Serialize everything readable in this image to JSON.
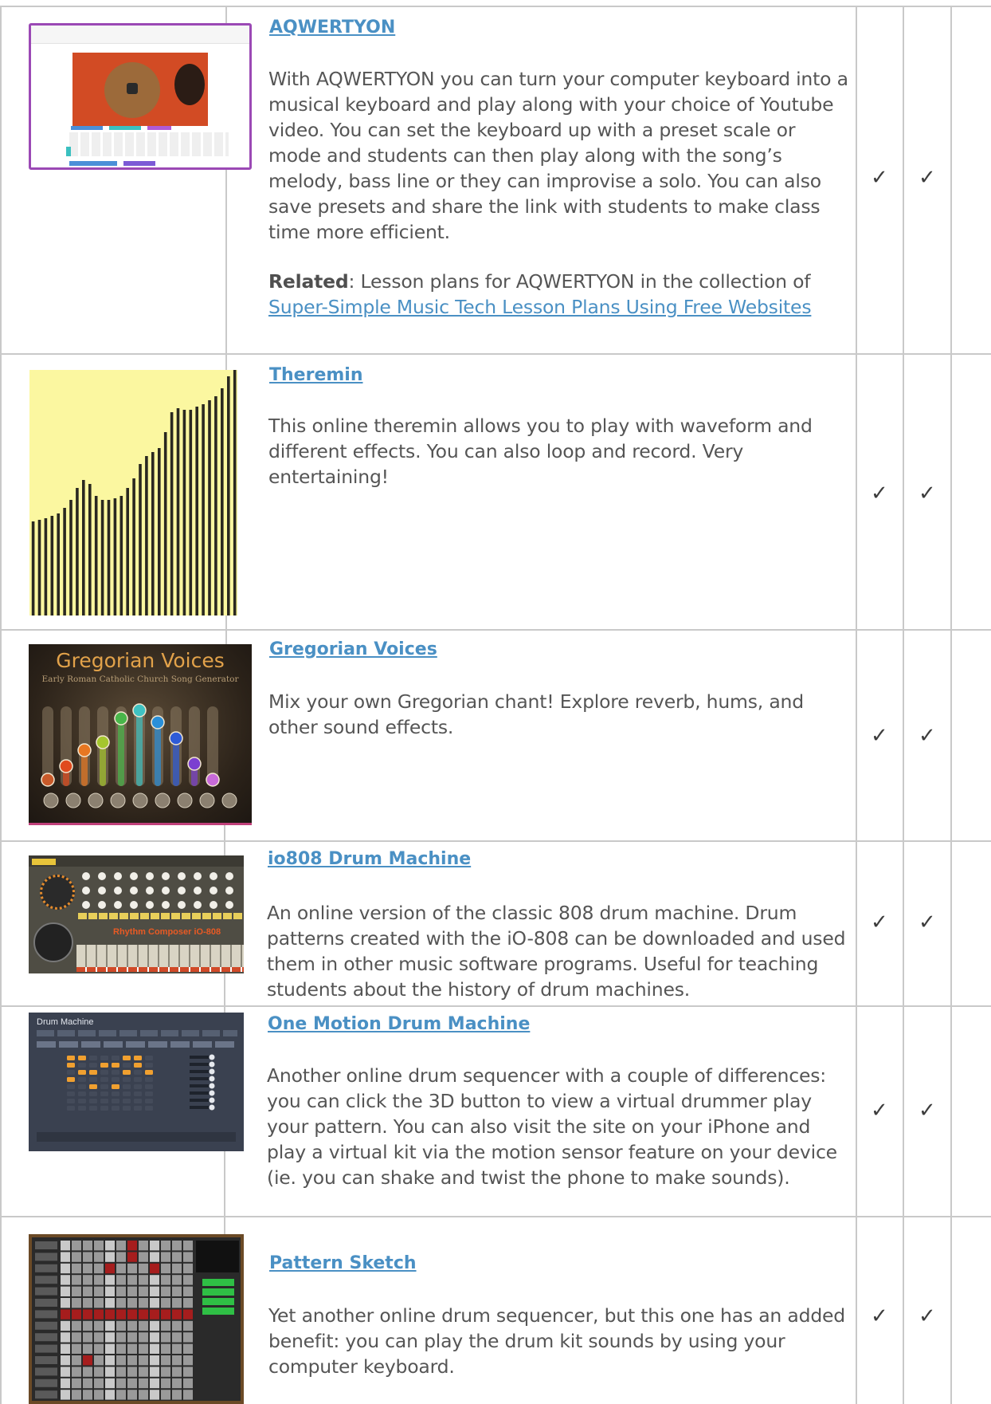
{
  "rows": [
    {
      "title": "AQWERTYON",
      "description": "With AQWERTYON you can turn your computer keyboard into a musical keyboard and play along with your choice of Youtube video. You can set the keyboard up with a preset scale or mode and students can then play along with the song’s melody, bass line or they can improvise a solo.  You can also save presets and share the link with students to make class time more efficient.",
      "related_label": "Related",
      "related_text": ": Lesson plans for AQWERTYON in the collection of ",
      "related_link": "Super-Simple Music Tech Lesson Plans Using Free Websites",
      "check1": "✓",
      "check2": "✓"
    },
    {
      "title": "Theremin",
      "description": "This online theremin allows you to play with waveform and different effects. You can also loop and record. Very entertaining!",
      "check1": "✓",
      "check2": "✓"
    },
    {
      "title": "Gregorian Voices",
      "description": "Mix your own Gregorian chant!  Explore reverb, hums, and other sound effects.",
      "thumb_title": "Gregorian Voices",
      "thumb_subtitle": "Early Roman Catholic Church Song Generator",
      "check1": "✓",
      "check2": "✓"
    },
    {
      "title": "io808 Drum Machine",
      "description": "An online version of the classic 808 drum machine. Drum patterns created with the iO-808 can be downloaded and used them in other music software programs. Useful for teaching students about the history of drum machines.",
      "thumb_label": "Rhythm Composer  iO-808",
      "check1": "✓",
      "check2": "✓"
    },
    {
      "title": "One Motion Drum Machine",
      "description": "Another online drum sequencer with a couple of differences: you can click the 3D button to view a virtual drummer play your pattern. You can also visit the site on your iPhone and play a virtual kit via the motion sensor feature on your device (ie. you can shake and twist the phone to make sounds).",
      "thumb_title": "Drum Machine",
      "check1": "✓",
      "check2": "✓"
    },
    {
      "title": "Pattern Sketch",
      "description": "Yet another online drum sequencer, but this one has an added benefit: you can play the drum kit sounds by using your computer keyboard.",
      "check1": "✓",
      "check2": "✓"
    }
  ],
  "colors": {
    "link": "#4a90c4",
    "text": "#555555",
    "border": "#c9c9c9"
  }
}
